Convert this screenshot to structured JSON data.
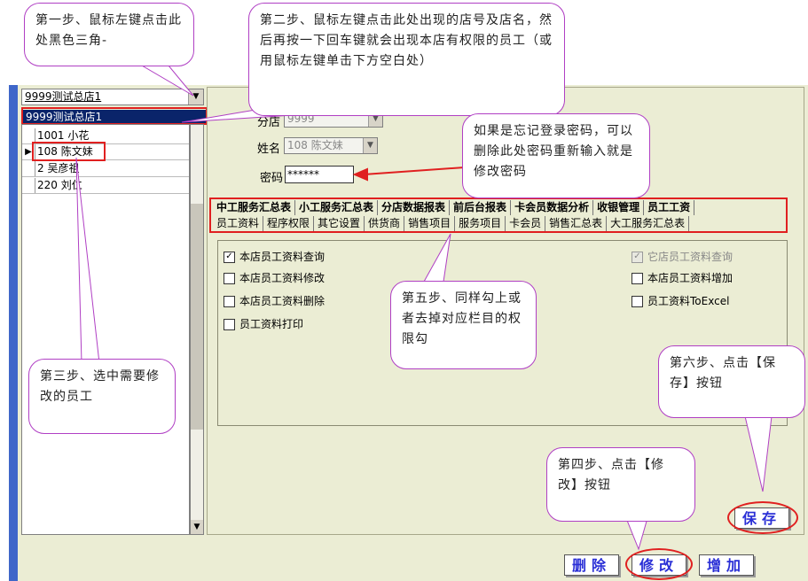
{
  "store_combo": {
    "value": "9999测试总店1",
    "selected_option": "9999测试总店1"
  },
  "employees": [
    {
      "text": "1001 小花",
      "marker": ""
    },
    {
      "text": "108  陈文妹",
      "marker": "▶"
    },
    {
      "text": "2    吴彦祖",
      "marker": ""
    },
    {
      "text": "220  刘仁",
      "marker": ""
    }
  ],
  "form": {
    "branch_label": "分店",
    "branch_value": "9999",
    "name_label": "姓名",
    "name_value": "108 陈文妹",
    "password_label": "密码",
    "password_value": "******"
  },
  "tabs_row1": [
    "中工服务汇总表",
    "小工服务汇总表",
    "分店数据报表",
    "前后台报表",
    "卡会员数据分析",
    "收银管理",
    "员工工资"
  ],
  "tabs_row2": [
    "员工资料",
    "程序权限",
    "其它设置",
    "供货商",
    "销售项目",
    "服务项目",
    "卡会员",
    "销售汇总表",
    "大工服务汇总表"
  ],
  "permissions": [
    {
      "label": "本店员工资料查询",
      "checked": true,
      "disabled": false
    },
    {
      "label": "本店员工资料修改",
      "checked": false,
      "disabled": false
    },
    {
      "label": "本店员工资料删除",
      "checked": false,
      "disabled": false
    },
    {
      "label": "员工资料打印",
      "checked": false,
      "disabled": false
    },
    {
      "label": "它店员工资料查询",
      "checked": true,
      "disabled": true
    },
    {
      "label": "本店员工资料增加",
      "checked": false,
      "disabled": false
    },
    {
      "label": "员工资料ToExcel",
      "checked": false,
      "disabled": false
    }
  ],
  "buttons": {
    "save": "保存",
    "delete": "删除",
    "modify": "修改",
    "add": "增加"
  },
  "callouts": {
    "step1": "第一步、鼠标左键点击此处黑色三角-",
    "step2": "第二步、鼠标左键点击此处出现的店号及店名，然后再按一下回车键就会出现本店有权限的员工（或用鼠标左键单击下方空白处）",
    "password_hint": "如果是忘记登录密码，可以删除此处密码重新输入就是修改密码",
    "step3": "第三步、选中需要修改的员工",
    "step5": "第五步、同样勾上或者去掉对应栏目的权限勾",
    "step6": "第六步、点击【保存】按钮",
    "step4": "第四步、点击【修改】按钮"
  },
  "colors": {
    "callout_border": "#b03fc4",
    "highlight_red": "#e02020",
    "selection_blue": "#0a246a",
    "button_text": "#2a2fd6"
  }
}
